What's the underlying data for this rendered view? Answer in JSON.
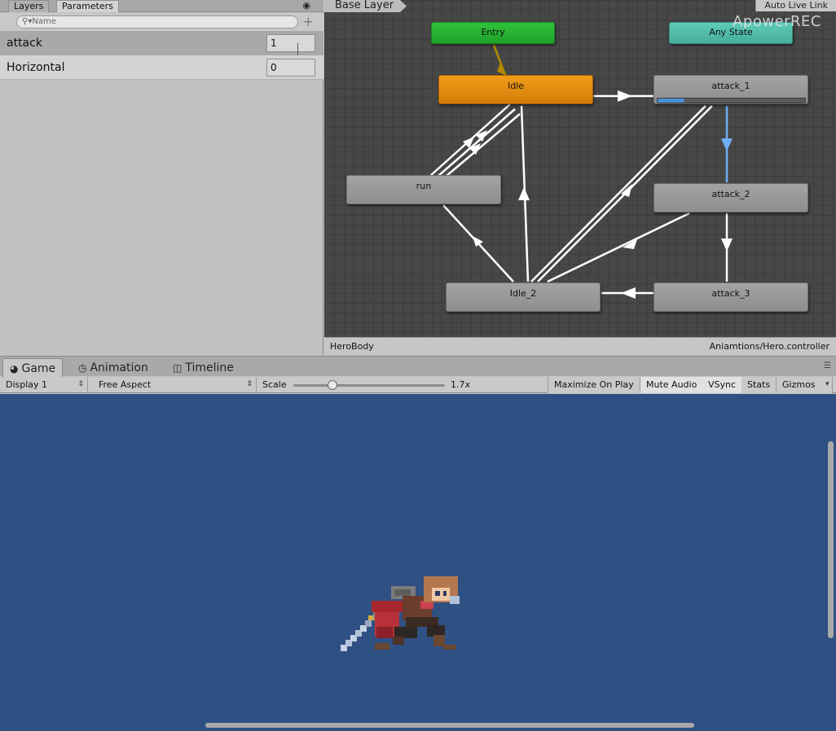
{
  "left_panel": {
    "tabs": [
      "Layers",
      "Parameters"
    ],
    "search_placeholder": "Name",
    "parameters": [
      {
        "name": "attack",
        "value": "1"
      },
      {
        "name": "Horizontal",
        "value": "0"
      }
    ]
  },
  "graph": {
    "layer": "Base Layer",
    "auto_live_link": "Auto Live Link",
    "watermark": "ApowerREC",
    "states": {
      "entry": "Entry",
      "any_state": "Any State",
      "idle": "Idle",
      "attack_1": "attack_1",
      "run": "run",
      "attack_2": "attack_2",
      "idle_2": "Idle_2",
      "attack_3": "attack_3"
    },
    "attack_1_progress": 0.18,
    "footer_object": "HeroBody",
    "footer_controller": "Aniamtions/Hero.controller"
  },
  "game_panel": {
    "tabs": [
      "Game",
      "Animation",
      "Timeline"
    ],
    "display": "Display 1",
    "aspect": "Free Aspect",
    "scale_label": "Scale",
    "scale_value": "1.7x",
    "scale_fraction": 0.26,
    "buttons": [
      "Maximize On Play",
      "Mute Audio",
      "VSync",
      "Stats",
      "Gizmos"
    ]
  },
  "colors": {
    "viewport": "#2f5083",
    "entry": "#2fc43b",
    "any_state": "#5ecbb7",
    "default_state": "#f19d1a",
    "progress": "#4a90d9"
  }
}
